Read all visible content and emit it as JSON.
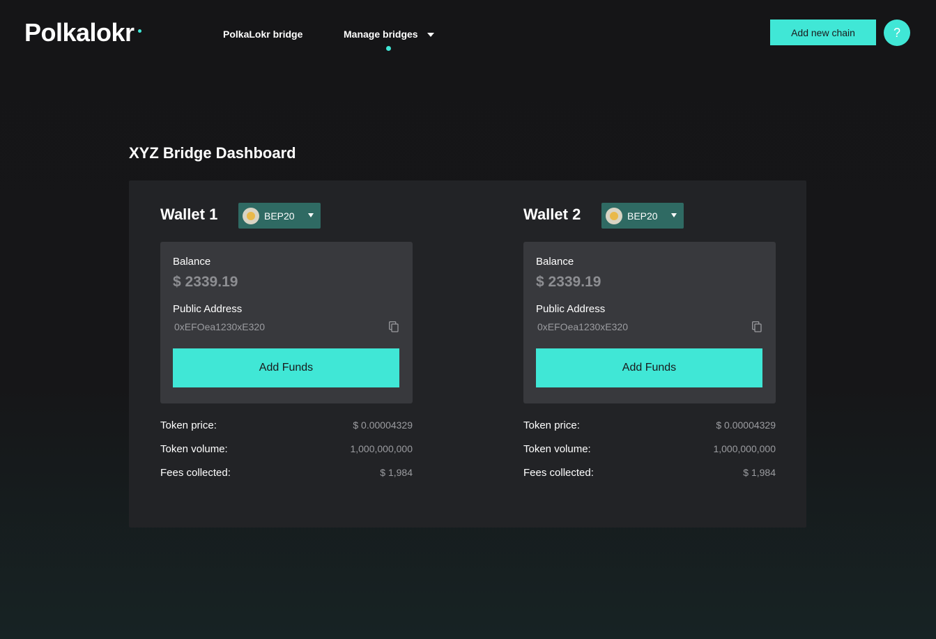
{
  "header": {
    "logo_text": "Polkalokr",
    "nav": [
      {
        "label": "PolkaLokr bridge"
      },
      {
        "label": "Manage bridges"
      }
    ],
    "add_chain_label": "Add new chain",
    "help_label": "?"
  },
  "colors": {
    "accent": "#40e7d6",
    "background": "#151517",
    "panel": "#222326",
    "card": "#38393d",
    "token_select": "#2f6a63"
  },
  "page": {
    "title": "XYZ Bridge Dashboard"
  },
  "wallets": [
    {
      "title": "Wallet 1",
      "token": "BEP20",
      "balance_label": "Balance",
      "balance": "$ 2339.19",
      "address_label": "Public Address",
      "address": "0xEFOea1230xE320",
      "add_funds_label": "Add Funds",
      "stats": [
        {
          "label": "Token price:",
          "value": "$ 0.00004329"
        },
        {
          "label": "Token volume:",
          "value": "1,000,000,000"
        },
        {
          "label": "Fees collected:",
          "value": "$ 1,984"
        }
      ]
    },
    {
      "title": "Wallet 2",
      "token": "BEP20",
      "balance_label": "Balance",
      "balance": "$ 2339.19",
      "address_label": "Public Address",
      "address": "0xEFOea1230xE320",
      "add_funds_label": "Add Funds",
      "stats": [
        {
          "label": "Token price:",
          "value": "$ 0.00004329"
        },
        {
          "label": "Token volume:",
          "value": "1,000,000,000"
        },
        {
          "label": "Fees collected:",
          "value": "$ 1,984"
        }
      ]
    }
  ],
  "icons": {
    "token": "bnb-coin-icon",
    "copy": "copy-icon",
    "dropdown": "chevron-down-icon"
  }
}
